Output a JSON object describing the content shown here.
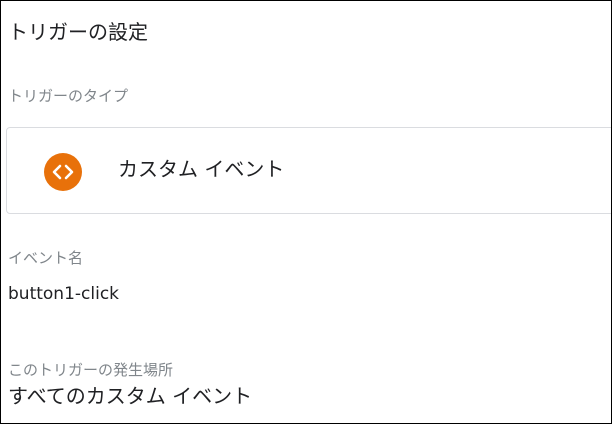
{
  "panel": {
    "title": "トリガーの設定"
  },
  "trigger_type": {
    "label": "トリガーのタイプ",
    "name": "カスタム イベント",
    "icon": "code-brackets-icon",
    "icon_color": "#e8710a"
  },
  "event_name": {
    "label": "イベント名",
    "value": "button1-click"
  },
  "fires_on": {
    "label": "このトリガーの発生場所",
    "value": "すべてのカスタム イベント"
  }
}
